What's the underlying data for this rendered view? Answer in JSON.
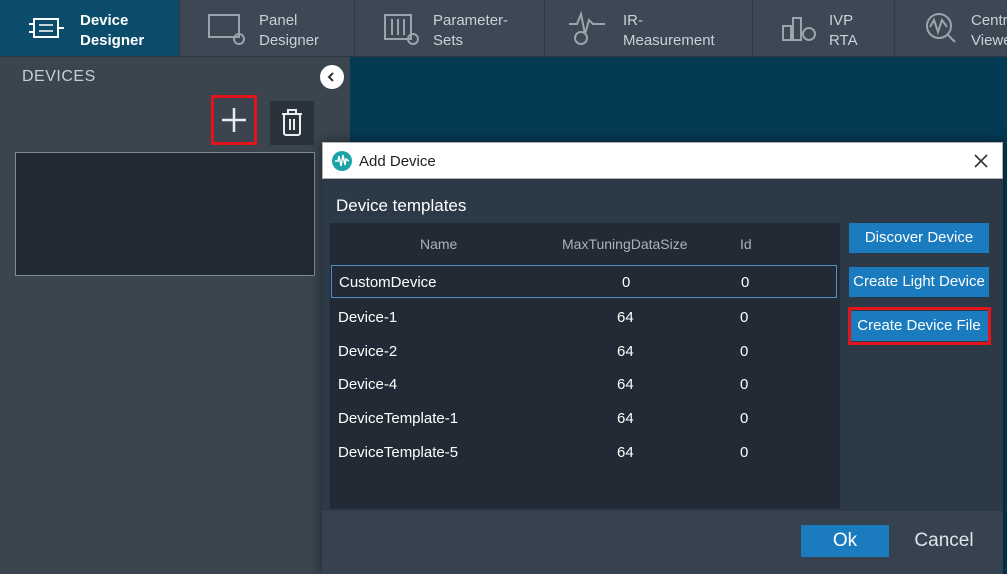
{
  "tabs": [
    {
      "line1": "Device",
      "line2": "Designer",
      "icon": "device-designer-icon",
      "active": true
    },
    {
      "line1": "Panel",
      "line2": "Designer",
      "icon": "panel-designer-icon",
      "active": false
    },
    {
      "line1": "Parameter-",
      "line2": "Sets",
      "icon": "parameter-sets-icon",
      "active": false
    },
    {
      "line1": "IR-",
      "line2": "Measurement",
      "icon": "ir-measurement-icon",
      "active": false
    },
    {
      "line1": "IVP",
      "line2": "RTA",
      "icon": "ivp-rta-icon",
      "active": false
    },
    {
      "line1": "Centr",
      "line2": "Viewe",
      "icon": "central-viewer-icon",
      "active": false
    }
  ],
  "left_panel": {
    "title": "DEVICES"
  },
  "dialog": {
    "title": "Add Device",
    "section_title": "Device templates",
    "columns": [
      "Name",
      "MaxTuningDataSize",
      "Id"
    ],
    "rows": [
      {
        "name": "CustomDevice",
        "size": "0",
        "id": "0",
        "selected": true
      },
      {
        "name": "Device-1",
        "size": "64",
        "id": "0",
        "selected": false
      },
      {
        "name": "Device-2",
        "size": "64",
        "id": "0",
        "selected": false
      },
      {
        "name": "Device-4",
        "size": "64",
        "id": "0",
        "selected": false
      },
      {
        "name": "DeviceTemplate-1",
        "size": "64",
        "id": "0",
        "selected": false
      },
      {
        "name": "DeviceTemplate-5",
        "size": "64",
        "id": "0",
        "selected": false
      }
    ],
    "buttons": {
      "discover": "Discover Device",
      "light": "Create Light Device",
      "file": "Create Device File"
    },
    "ok": "Ok",
    "cancel": "Cancel"
  },
  "colors": {
    "accent": "#1a7bbf",
    "highlight": "#e3151c",
    "background": "#053a55"
  }
}
